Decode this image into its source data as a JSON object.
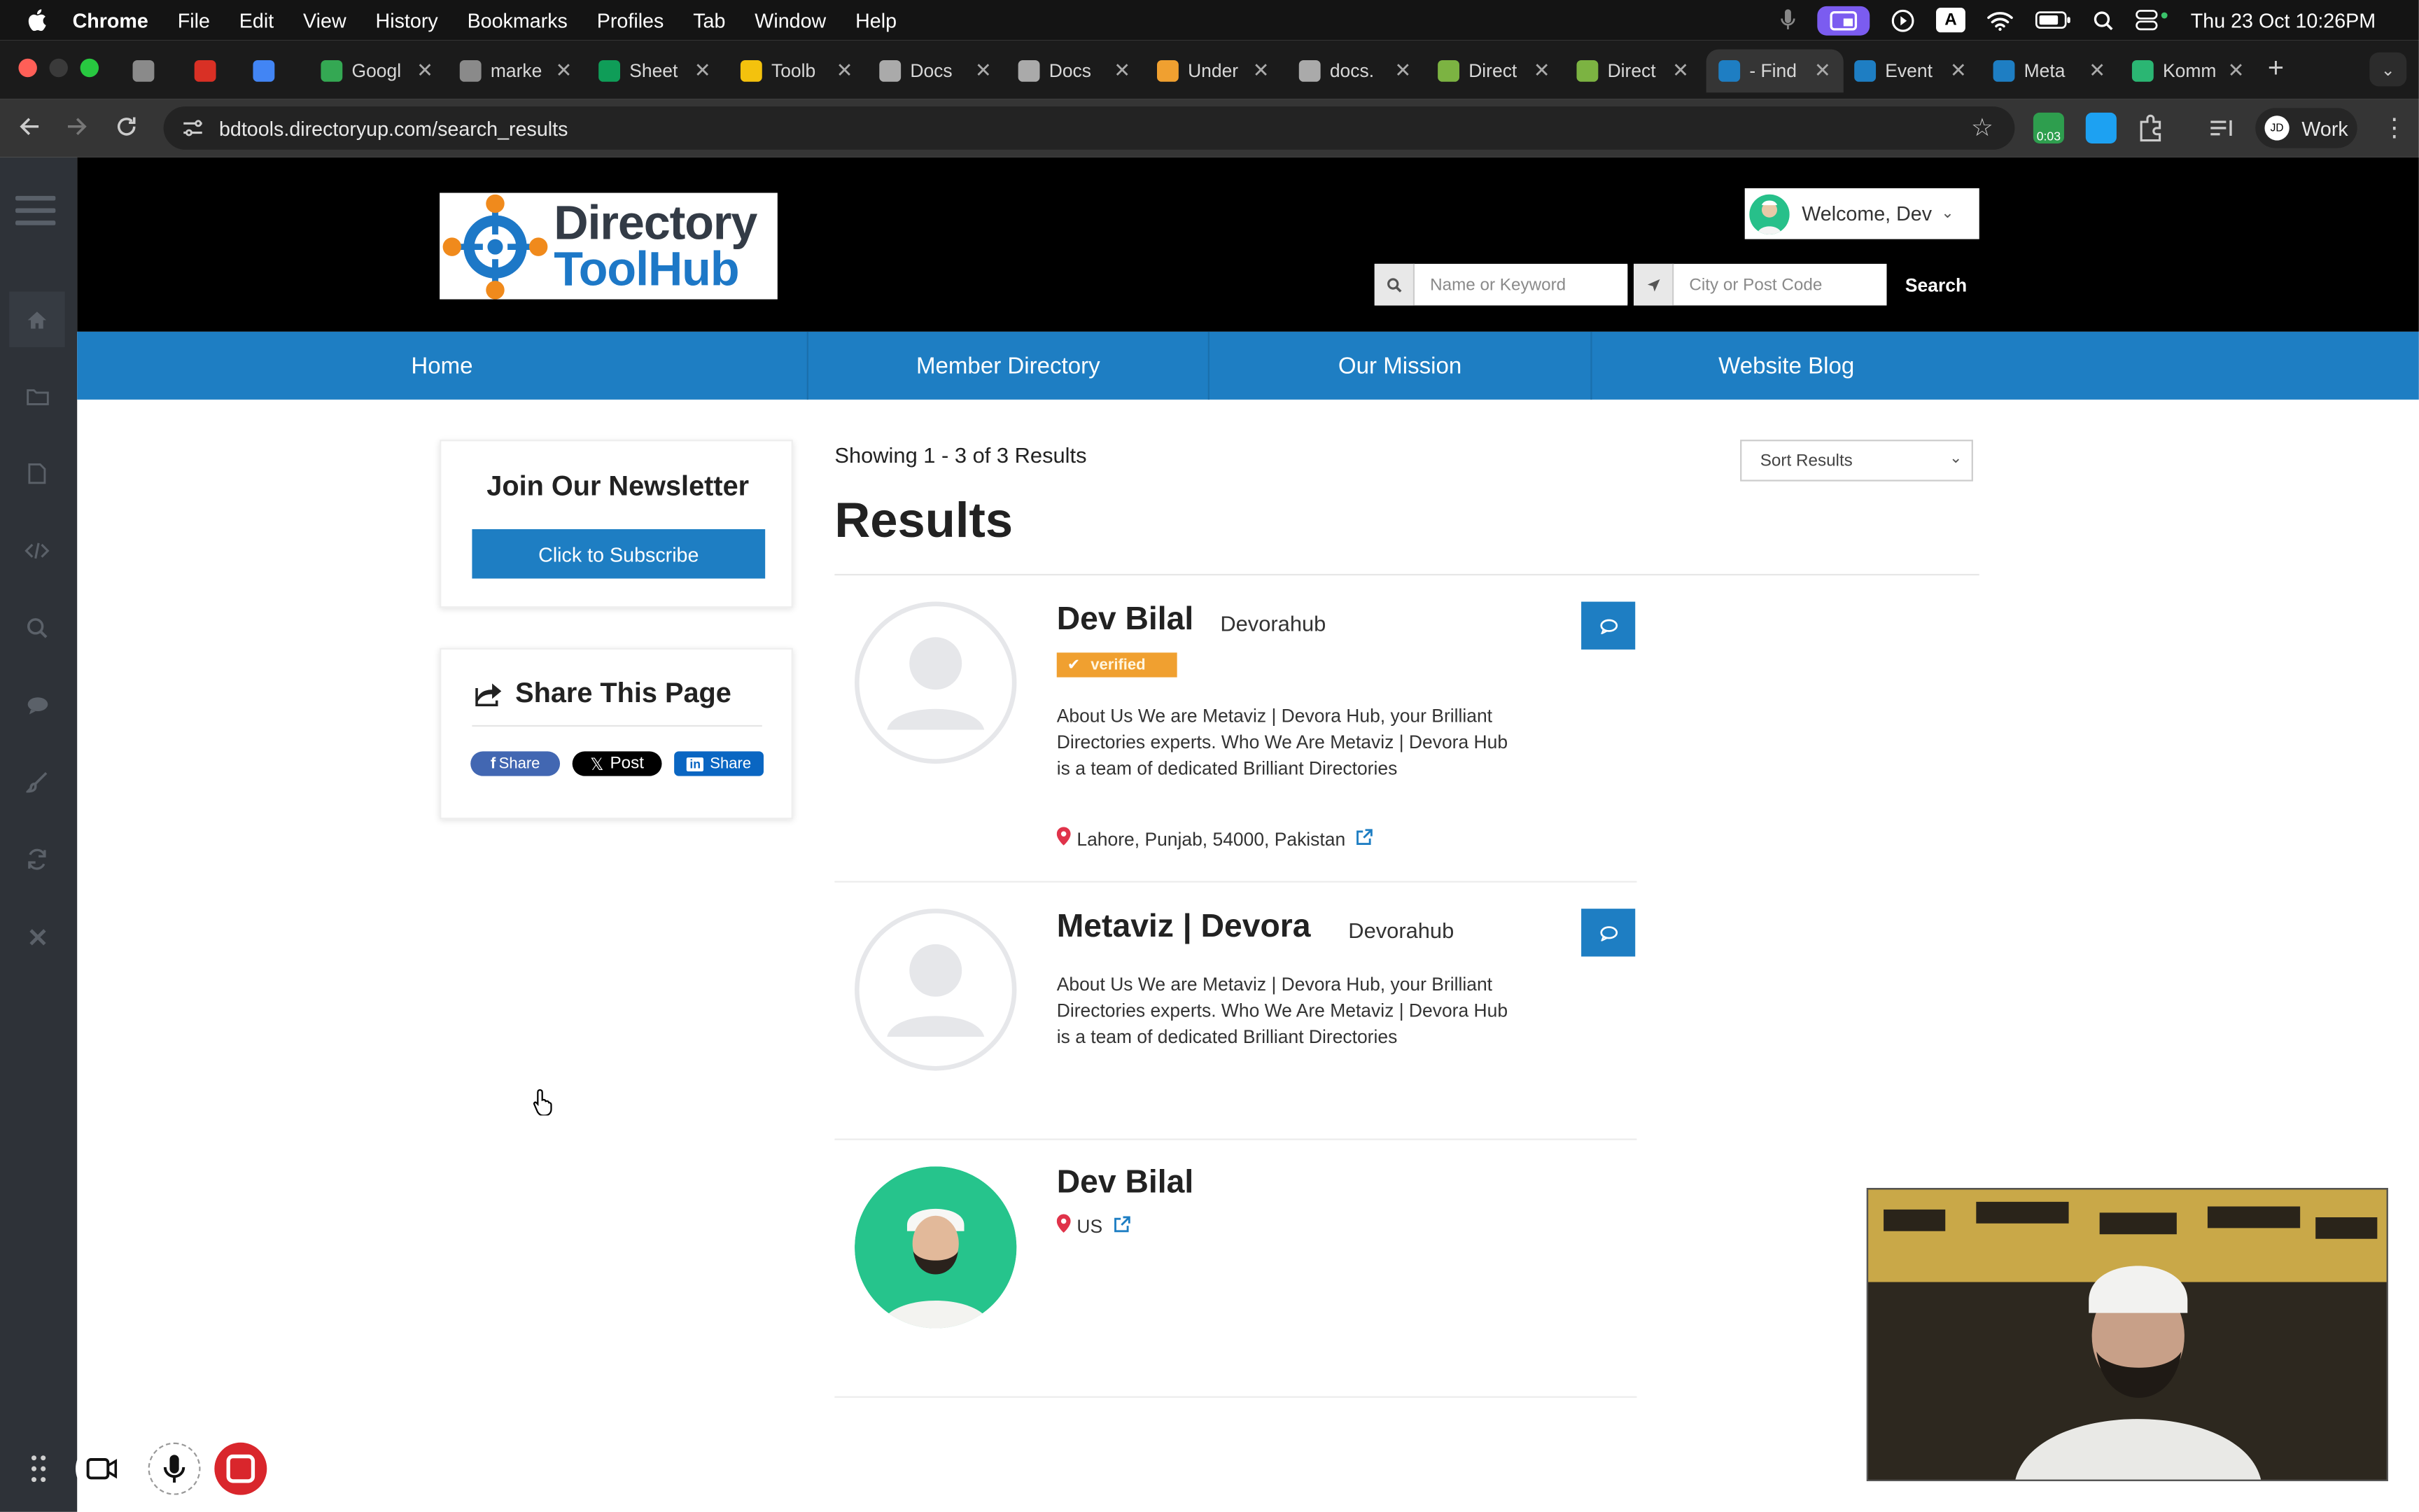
{
  "menubar": {
    "app": "Chrome",
    "items": [
      "File",
      "Edit",
      "View",
      "History",
      "Bookmarks",
      "Profiles",
      "Tab",
      "Window",
      "Help"
    ],
    "datetime": "Thu 23 Oct  10:26PM",
    "a_badge": "A"
  },
  "tabs": [
    {
      "label": "",
      "color": "#8a8a8a"
    },
    {
      "label": "",
      "color": "#d93025"
    },
    {
      "label": "",
      "color": "#4285f4"
    },
    {
      "label": "Googl",
      "color": "#34a853"
    },
    {
      "label": "marke",
      "color": "#8a8a8a"
    },
    {
      "label": "Sheet",
      "color": "#0f9d58"
    },
    {
      "label": "Toolb",
      "color": "#f4c20d"
    },
    {
      "label": "Docs",
      "color": "#aaaaaa"
    },
    {
      "label": "Docs",
      "color": "#aaaaaa"
    },
    {
      "label": "Under",
      "color": "#f0a030"
    },
    {
      "label": "docs.",
      "color": "#aaaaaa"
    },
    {
      "label": "Direct",
      "color": "#7cb342"
    },
    {
      "label": "Direct",
      "color": "#7cb342"
    },
    {
      "label": "- Find",
      "color": "#1e7ec3"
    },
    {
      "label": "Event",
      "color": "#1e7ec3"
    },
    {
      "label": "Meta",
      "color": "#1e7ec3"
    },
    {
      "label": "Komm",
      "color": "#2bb673"
    }
  ],
  "address": {
    "url": "bdtools.directoryup.com/search_results",
    "timer_badge": "0:03",
    "profile_label": "Work",
    "profile_badge": "JD"
  },
  "site": {
    "logo_line1": "Directory",
    "logo_line2": "ToolHub",
    "welcome": "Welcome, Dev",
    "search_keyword_placeholder": "Name or Keyword",
    "search_location_placeholder": "City or Post Code",
    "search_button": "Search",
    "nav": [
      "Home",
      "Member Directory",
      "Our Mission",
      "Website Blog"
    ]
  },
  "sidebar_widgets": {
    "newsletter_title": "Join Our Newsletter",
    "subscribe_button": "Click to Subscribe",
    "share_title": "Share This Page",
    "share_facebook": "Share",
    "share_x": "Post",
    "share_linkedin": "Share"
  },
  "results": {
    "showing": "Showing 1 - 3 of 3 Results",
    "heading": "Results",
    "sort_label": "Sort Results",
    "items": [
      {
        "name": "Dev Bilal",
        "company": "Devorahub",
        "badge": "verified",
        "description": "About Us We are Metaviz | Devora Hub, your Brilliant Directories experts. Who We Are Metaviz | Devora Hub is a team of dedicated Brilliant Directories",
        "location": "Lahore, Punjab, 54000, Pakistan"
      },
      {
        "name": "Metaviz | Devora",
        "company": "Devorahub",
        "description": "About Us We are Metaviz | Devora Hub, your Brilliant Directories experts. Who We Are Metaviz | Devora Hub is a team of dedicated Brilliant Directories"
      },
      {
        "name": "Dev Bilal",
        "location": "US"
      }
    ]
  },
  "colors": {
    "brand_blue": "#1e7ec3",
    "verified_orange": "#f0a030",
    "recording_red": "#d9262c"
  }
}
